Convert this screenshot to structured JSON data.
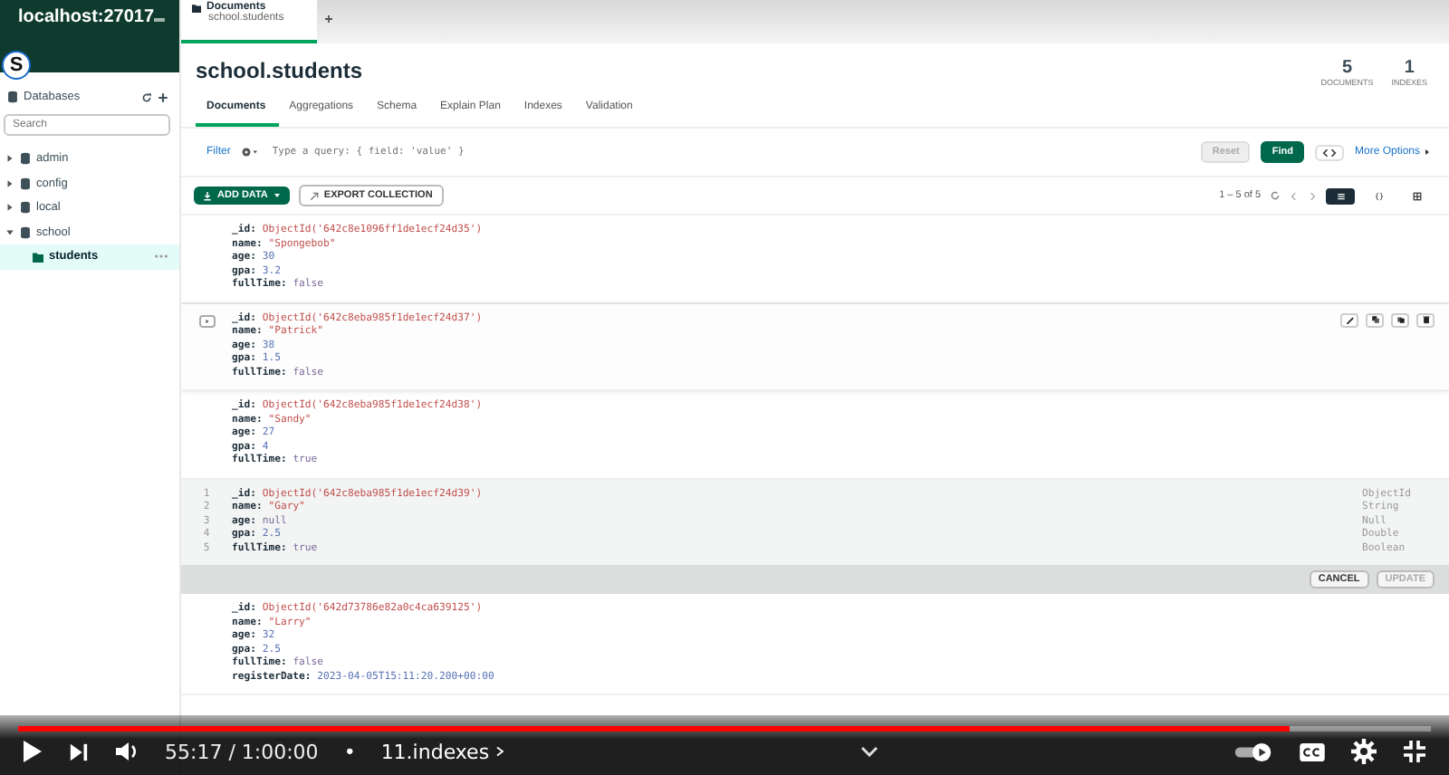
{
  "sidebar": {
    "connection": "localhost:27017",
    "section": "Databases",
    "search_placeholder": "Search",
    "databases": [
      {
        "name": "admin",
        "expanded": false
      },
      {
        "name": "config",
        "expanded": false
      },
      {
        "name": "local",
        "expanded": false
      },
      {
        "name": "school",
        "expanded": true,
        "children": [
          {
            "name": "students",
            "selected": true
          }
        ]
      }
    ]
  },
  "tab": {
    "title": "Documents",
    "subtitle": "school.students"
  },
  "collection": {
    "title": "school.students",
    "stats": [
      {
        "value": "5",
        "label": "DOCUMENTS"
      },
      {
        "value": "1",
        "label": "INDEXES"
      }
    ]
  },
  "subtabs": [
    {
      "label": "Documents",
      "selected": true
    },
    {
      "label": "Aggregations",
      "selected": false
    },
    {
      "label": "Schema",
      "selected": false
    },
    {
      "label": "Explain Plan",
      "selected": false
    },
    {
      "label": "Indexes",
      "selected": false
    },
    {
      "label": "Validation",
      "selected": false
    }
  ],
  "query": {
    "filter_label": "Filter",
    "placeholder": "Type a query: { field: 'value' }",
    "reset": "Reset",
    "find": "Find",
    "more_options": "More Options"
  },
  "toolbar": {
    "add_data": "ADD DATA",
    "export": "EXPORT COLLECTION",
    "pagination": "1 – 5 of 5"
  },
  "documents": [
    {
      "kind": "view",
      "hovered": false,
      "fields": [
        {
          "key": "_id:",
          "value": "ObjectId('642c8e1096ff1de1ecf24d35')",
          "kind": "oid"
        },
        {
          "key": "name:",
          "value": "\"Spongebob\"",
          "kind": "string"
        },
        {
          "key": "age:",
          "value": "30",
          "kind": "number"
        },
        {
          "key": "gpa:",
          "value": "3.2",
          "kind": "number"
        },
        {
          "key": "fullTime:",
          "value": "false",
          "kind": "bool"
        }
      ]
    },
    {
      "kind": "view",
      "hovered": true,
      "fields": [
        {
          "key": "_id:",
          "value": "ObjectId('642c8eba985f1de1ecf24d37')",
          "kind": "oid"
        },
        {
          "key": "name:",
          "value": "\"Patrick\"",
          "kind": "string"
        },
        {
          "key": "age:",
          "value": "38",
          "kind": "number"
        },
        {
          "key": "gpa:",
          "value": "1.5",
          "kind": "number"
        },
        {
          "key": "fullTime:",
          "value": "false",
          "kind": "bool"
        }
      ]
    },
    {
      "kind": "view",
      "hovered": false,
      "fields": [
        {
          "key": "_id:",
          "value": "ObjectId('642c8eba985f1de1ecf24d38')",
          "kind": "oid"
        },
        {
          "key": "name:",
          "value": "\"Sandy\"",
          "kind": "string"
        },
        {
          "key": "age:",
          "value": "27",
          "kind": "number"
        },
        {
          "key": "gpa:",
          "value": "4",
          "kind": "number"
        },
        {
          "key": "fullTime:",
          "value": "true",
          "kind": "bool"
        }
      ]
    },
    {
      "kind": "edit",
      "cancel": "CANCEL",
      "update": "UPDATE",
      "fields": [
        {
          "line": "1",
          "key": "_id:",
          "value": "ObjectId('642c8eba985f1de1ecf24d39')",
          "kind": "oid",
          "type_label": "ObjectId"
        },
        {
          "line": "2",
          "key": "name:",
          "value": "\"Gary\"",
          "kind": "string",
          "type_label": "String"
        },
        {
          "line": "3",
          "key": "age:",
          "value": "null",
          "kind": "null",
          "type_label": "Null"
        },
        {
          "line": "4",
          "key": "gpa:",
          "value": "2.5",
          "kind": "number",
          "type_label": "Double"
        },
        {
          "line": "5",
          "key": "fullTime:",
          "value": "true",
          "kind": "bool",
          "type_label": "Boolean"
        }
      ]
    },
    {
      "kind": "view",
      "hovered": false,
      "fields": [
        {
          "key": "_id:",
          "value": "ObjectId('642d73786e82a0c4ca639125')",
          "kind": "oid"
        },
        {
          "key": "name:",
          "value": "\"Larry\"",
          "kind": "string"
        },
        {
          "key": "age:",
          "value": "32",
          "kind": "number"
        },
        {
          "key": "gpa:",
          "value": "2.5",
          "kind": "number"
        },
        {
          "key": "fullTime:",
          "value": "false",
          "kind": "bool"
        },
        {
          "key": "registerDate:",
          "value": "2023-04-05T15:11:20.200+00:00",
          "kind": "date"
        }
      ]
    }
  ],
  "player": {
    "channel_avatar": "S",
    "progress": {
      "level": 0.9
    },
    "time": "55:17 / 1:00:00",
    "separator": "•",
    "chapter": "11.indexes"
  }
}
